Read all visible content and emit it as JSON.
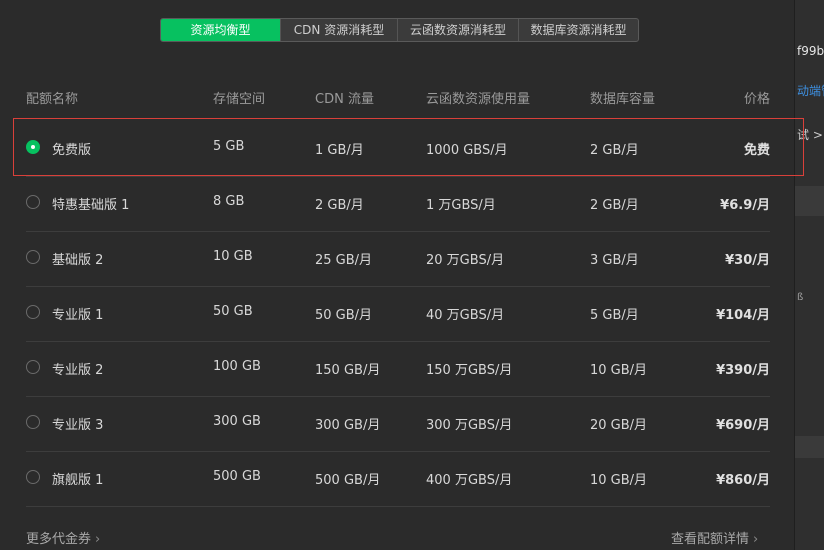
{
  "tabs": [
    {
      "label": "资源均衡型",
      "active": true
    },
    {
      "label": "CDN 资源消耗型",
      "active": false
    },
    {
      "label": "云函数资源消耗型",
      "active": false
    },
    {
      "label": "数据库资源消耗型",
      "active": false
    }
  ],
  "table": {
    "headers": {
      "name": "配额名称",
      "storage": "存储空间",
      "cdn": "CDN 流量",
      "func": "云函数资源使用量",
      "db": "数据库容量",
      "price": "价格"
    },
    "rows": [
      {
        "name": "免费版",
        "storage": "5 GB",
        "cdn": "1 GB/月",
        "func": "1000 GBS/月",
        "db": "2 GB/月",
        "price": "免费",
        "selected": true
      },
      {
        "name": "特惠基础版 1",
        "storage": "8 GB",
        "cdn": "2 GB/月",
        "func": "1 万GBS/月",
        "db": "2 GB/月",
        "price": "¥6.9/月",
        "selected": false
      },
      {
        "name": "基础版 2",
        "storage": "10 GB",
        "cdn": "25 GB/月",
        "func": "20 万GBS/月",
        "db": "3 GB/月",
        "price": "¥30/月",
        "selected": false
      },
      {
        "name": "专业版 1",
        "storage": "50 GB",
        "cdn": "50 GB/月",
        "func": "40 万GBS/月",
        "db": "5 GB/月",
        "price": "¥104/月",
        "selected": false
      },
      {
        "name": "专业版 2",
        "storage": "100 GB",
        "cdn": "150 GB/月",
        "func": "150 万GBS/月",
        "db": "10 GB/月",
        "price": "¥390/月",
        "selected": false
      },
      {
        "name": "专业版 3",
        "storage": "300 GB",
        "cdn": "300 GB/月",
        "func": "300 万GBS/月",
        "db": "20 GB/月",
        "price": "¥690/月",
        "selected": false
      },
      {
        "name": "旗舰版 1",
        "storage": "500 GB",
        "cdn": "500 GB/月",
        "func": "400 万GBS/月",
        "db": "10 GB/月",
        "price": "¥860/月",
        "selected": false
      }
    ]
  },
  "footer": {
    "coupons_label": "更多代金券",
    "details_label": "查看配额详情"
  },
  "background": {
    "text1": "f99b",
    "text2": "动端管",
    "text3": "试 >",
    "text4": "ß"
  },
  "colors": {
    "accent": "#07c160",
    "highlight_border": "#d9403a",
    "link_blue": "#3d8fe0"
  }
}
